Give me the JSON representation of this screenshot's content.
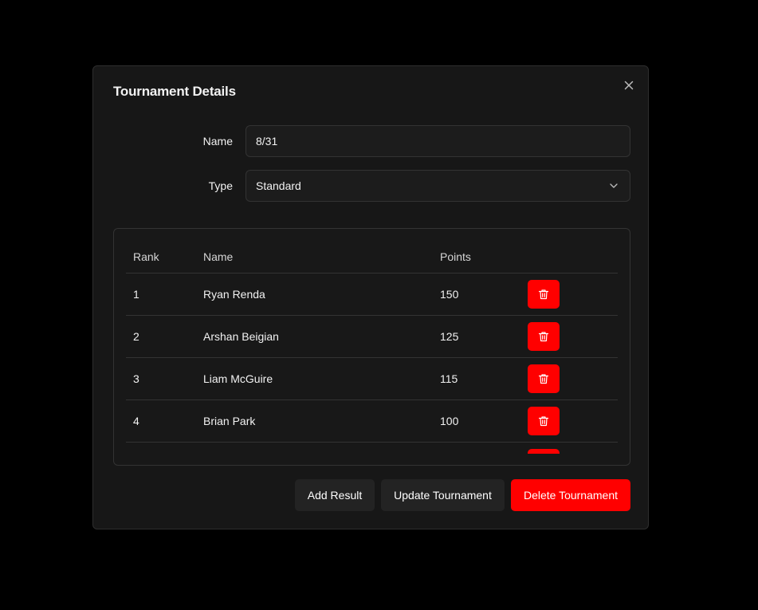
{
  "modal": {
    "title": "Tournament Details",
    "close_icon": "close-icon"
  },
  "form": {
    "name_label": "Name",
    "name_value": "8/31",
    "type_label": "Type",
    "type_value": "Standard"
  },
  "results_table": {
    "headers": {
      "rank": "Rank",
      "name": "Name",
      "points": "Points"
    },
    "rows": [
      {
        "rank": "1",
        "name": "Ryan Renda",
        "points": "150"
      },
      {
        "rank": "2",
        "name": "Arshan Beigian",
        "points": "125"
      },
      {
        "rank": "3",
        "name": "Liam McGuire",
        "points": "115"
      },
      {
        "rank": "4",
        "name": "Brian Park",
        "points": "100"
      },
      {
        "rank": "",
        "name": "",
        "points": ""
      }
    ],
    "row_action_icon": "trash-icon"
  },
  "footer": {
    "add_result_label": "Add Result",
    "update_label": "Update Tournament",
    "delete_label": "Delete Tournament"
  },
  "colors": {
    "danger": "#ff0000",
    "surface": "#171717",
    "border": "#333333"
  }
}
